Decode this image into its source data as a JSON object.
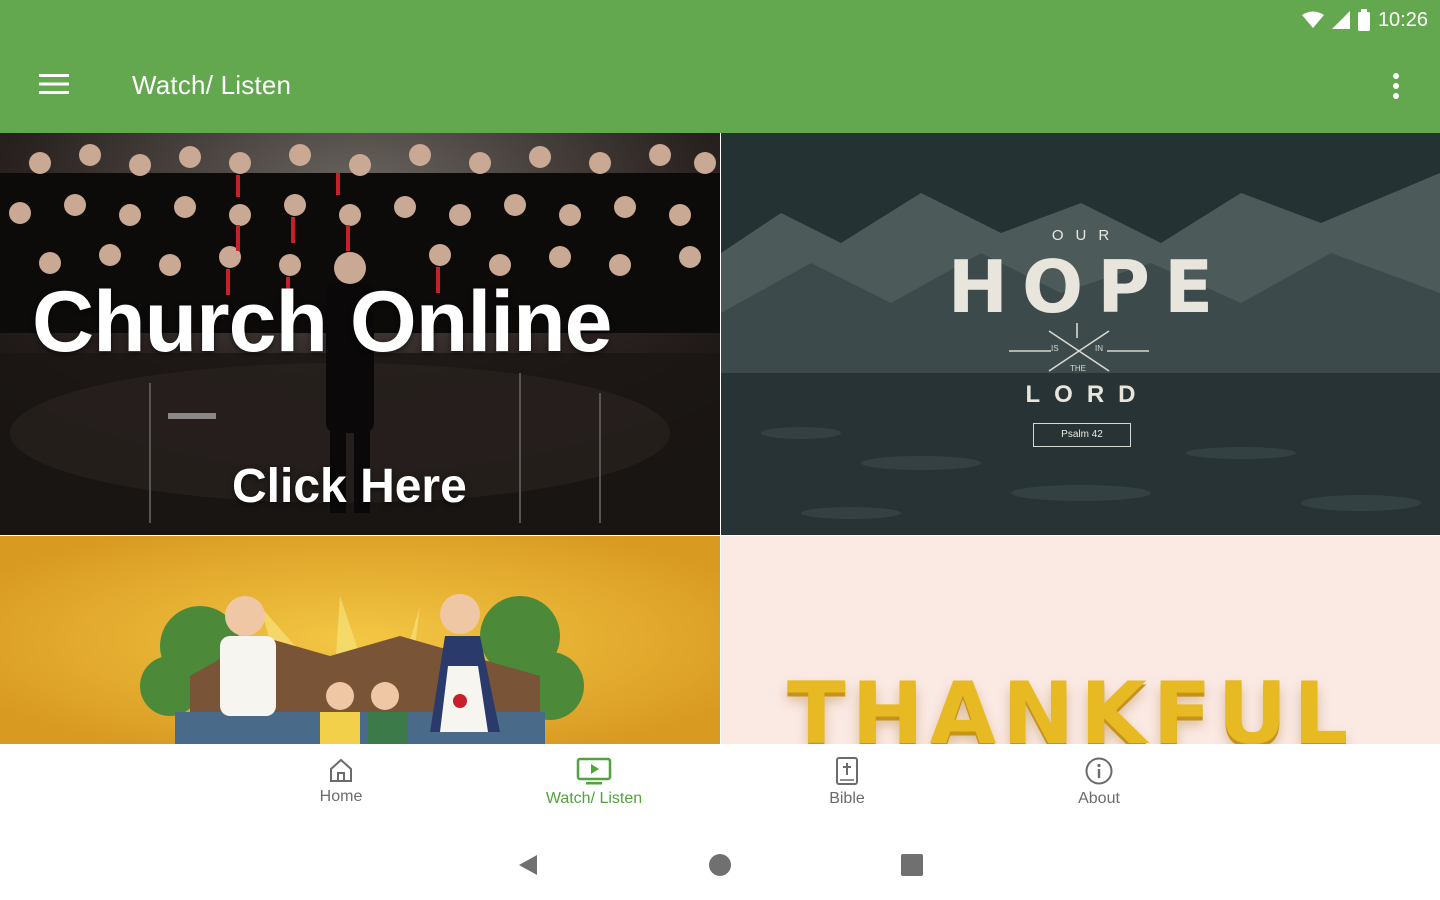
{
  "status_bar": {
    "time": "10:26"
  },
  "app_bar": {
    "title": "Watch/ Listen",
    "menu_icon": "hamburger-menu-icon",
    "overflow_icon": "more-vert-icon"
  },
  "tiles": [
    {
      "headline": "Church Online",
      "subline": "Click Here"
    },
    {
      "top": "OUR",
      "headline": "HOPE",
      "middle_left": "IS",
      "middle_right": "IN",
      "middle_center": "THE",
      "bottom": "LORD",
      "reference": "Psalm 42"
    },
    {},
    {
      "headline": "THANKFUL"
    }
  ],
  "bottom_nav": [
    {
      "label": "Home",
      "icon": "home-icon",
      "active": false
    },
    {
      "label": "Watch/ Listen",
      "icon": "tv-play-icon",
      "active": true
    },
    {
      "label": "Bible",
      "icon": "bible-icon",
      "active": false
    },
    {
      "label": "About",
      "icon": "info-icon",
      "active": false
    }
  ],
  "colors": {
    "primary": "#63a84f",
    "active_tab": "#4fa43c",
    "inactive_tab": "#6b6b6b"
  }
}
